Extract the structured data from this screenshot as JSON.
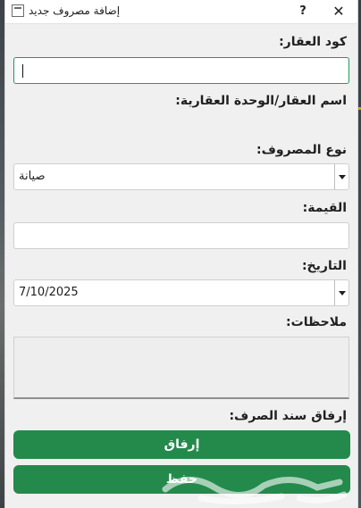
{
  "window": {
    "title": "إضافة مصروف جديد",
    "help_glyph": "?",
    "close_glyph": "✕"
  },
  "form": {
    "property_code": {
      "label": "كود العقار:",
      "value": ""
    },
    "property_name": {
      "label": "اسم العقار/الوحدة العقارية:",
      "value": ""
    },
    "expense_type": {
      "label": "نوع المصروف:",
      "selected": "صيانة"
    },
    "amount": {
      "label": "القيمة:",
      "value": ""
    },
    "date": {
      "label": "التاريخ:",
      "selected": "7/10/2025"
    },
    "notes": {
      "label": "ملاحظات:",
      "value": ""
    },
    "attachment": {
      "label": "إرفاق سند الصرف:"
    }
  },
  "buttons": {
    "attach_label": "إرفاق",
    "save_label": "حفظ"
  },
  "colors": {
    "accent_green": "#238a4c",
    "focus_border": "#1e9a6a",
    "dialog_bg": "#f0f0f0"
  },
  "icons": {
    "window": "window-app-icon",
    "help": "help-icon",
    "close": "close-icon",
    "dropdown": "chevron-down-icon"
  }
}
